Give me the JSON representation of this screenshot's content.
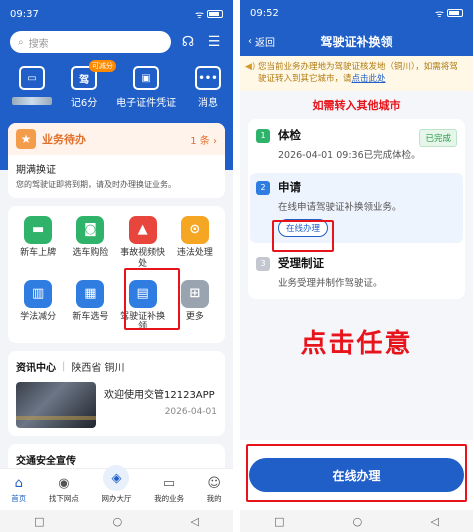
{
  "left": {
    "status": {
      "time": "09:37"
    },
    "search": {
      "placeholder": "搜索"
    },
    "quick": [
      {
        "label": "",
        "icon": "car-icon"
      },
      {
        "label": "记6分",
        "icon": "license-icon",
        "badge": "可减分",
        "glyph": "驾"
      },
      {
        "label": "电子证件凭证",
        "icon": "wallet-icon"
      },
      {
        "label": "消息",
        "icon": "message-icon"
      }
    ],
    "todo": {
      "title": "业务待办",
      "count": "1 条",
      "item_title": "期满换证",
      "item_desc": "您的驾驶证即将到期，请及时办理换证业务。"
    },
    "grid": [
      {
        "label": "新车上牌",
        "icon": "new-car-plate-icon",
        "color": "#2fb36a"
      },
      {
        "label": "选车购险",
        "icon": "car-insurance-icon",
        "color": "#2fb36a"
      },
      {
        "label": "事故视频快处",
        "icon": "accident-icon",
        "color": "#e8453c"
      },
      {
        "label": "违法处理",
        "icon": "violation-icon",
        "color": "#f5a623"
      },
      {
        "label": "学法减分",
        "icon": "study-icon",
        "color": "#2f7de1"
      },
      {
        "label": "新车选号",
        "icon": "plate-number-icon",
        "color": "#2f7de1"
      },
      {
        "label": "驾驶证补换领",
        "icon": "license-renew-icon",
        "color": "#2f7de1"
      },
      {
        "label": "更多",
        "icon": "more-icon",
        "color": "#9aa3b0"
      }
    ],
    "news": {
      "title": "资讯中心",
      "region": "陕西省 铜川",
      "item_title": "欢迎使用交管12123APP",
      "item_date": "2026-04-01"
    },
    "promo": {
      "title": "交通安全宣传"
    },
    "tabs": [
      {
        "label": "首页",
        "icon": "home-icon"
      },
      {
        "label": "找下网点",
        "icon": "location-icon"
      },
      {
        "label": "网办大厅",
        "icon": "hall-icon"
      },
      {
        "label": "我的业务",
        "icon": "business-icon"
      },
      {
        "label": "我的",
        "icon": "user-icon"
      }
    ]
  },
  "right": {
    "status": {
      "time": "09:52"
    },
    "header": {
      "back": "返回",
      "title": "驾驶证补换领"
    },
    "notice": {
      "text": "您当前业务办理地为驾驶证核发地（铜川），如需将驾驶证转入到其它城市，请",
      "link": "点击此处"
    },
    "annotation_top": "如需转入其他城市",
    "steps": [
      {
        "num": "1",
        "title": "体检",
        "desc": "2026-04-01 09:36已完成体检。",
        "status": "已完成"
      },
      {
        "num": "2",
        "title": "申请",
        "desc": "在线申请驾驶证补换领业务。",
        "action": "在线办理"
      },
      {
        "num": "3",
        "title": "受理制证",
        "desc": "业务受理并制作驾驶证。"
      }
    ],
    "annotation_big": "点击任意",
    "main_button": "在线办理"
  },
  "colors": {
    "primary": "#1f5fc7",
    "annotation": "#e8141b",
    "warning": "#b07a10"
  }
}
